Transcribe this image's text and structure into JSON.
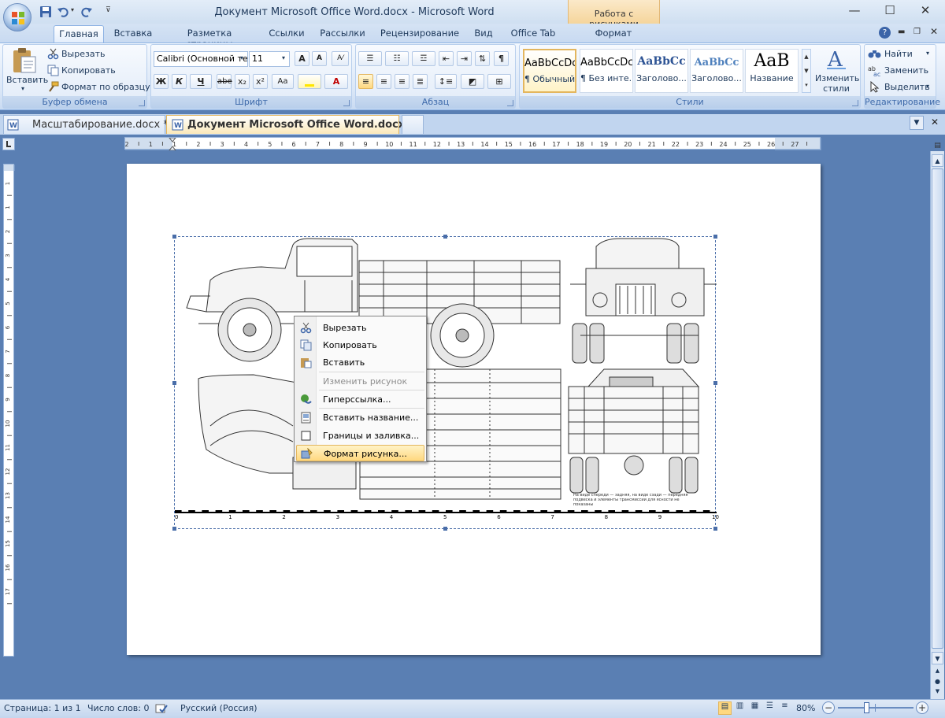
{
  "titlebar": {
    "title": "Документ Microsoft Office Word.docx - Microsoft Word",
    "context_tab": "Работа с рисунками",
    "minimize": "—",
    "maximize": "☐",
    "close": "✕"
  },
  "tabs": [
    "Главная",
    "Вставка",
    "Разметка страницы",
    "Ссылки",
    "Рассылки",
    "Рецензирование",
    "Вид",
    "Office Tab",
    "Формат"
  ],
  "ribbon": {
    "clipboard": {
      "label": "Буфер обмена",
      "paste": "Вставить",
      "cut": "Вырезать",
      "copy": "Копировать",
      "format_painter": "Формат по образцу"
    },
    "font": {
      "label": "Шрифт",
      "font_name": "Calibri (Основной те",
      "font_size": "11",
      "bold": "Ж",
      "italic": "К",
      "underline": "Ч",
      "strike": "abe",
      "subscript": "x₂",
      "superscript": "x²",
      "grow": "A",
      "shrink": "A",
      "change_case": "Aa",
      "font_color": "A"
    },
    "paragraph": {
      "label": "Абзац",
      "pilcrow": "¶"
    },
    "styles": {
      "label": "Стили",
      "items": [
        {
          "preview": "AaBbCcDc",
          "name": "¶ Обычный"
        },
        {
          "preview": "AaBbCcDc",
          "name": "¶ Без инте..."
        },
        {
          "preview": "AaBbCc",
          "name": "Заголово..."
        },
        {
          "preview": "AaBbCc",
          "name": "Заголово..."
        },
        {
          "preview": "AaB",
          "name": "Название"
        }
      ],
      "change_styles": "Изменить стили"
    },
    "editing": {
      "label": "Редактирование",
      "find": "Найти",
      "replace": "Заменить",
      "select": "Выделить"
    }
  },
  "doc_tabs": [
    {
      "label": "Масштабирование.docx *"
    },
    {
      "label": "Документ Microsoft Office Word.docx *"
    }
  ],
  "context_menu": {
    "items": [
      {
        "label": "Вырезать",
        "enabled": true
      },
      {
        "label": "Копировать",
        "enabled": true
      },
      {
        "label": "Вставить",
        "enabled": true
      },
      {
        "label": "Изменить рисунок",
        "enabled": false
      },
      {
        "label": "Гиперссылка...",
        "enabled": true
      },
      {
        "label": "Вставить название...",
        "enabled": true
      },
      {
        "label": "Границы и заливка...",
        "enabled": true
      },
      {
        "label": "Формат рисунка...",
        "enabled": true,
        "highlighted": true
      }
    ]
  },
  "drawing": {
    "scale_labels": [
      "0",
      "1",
      "2",
      "3",
      "4",
      "5",
      "6",
      "7",
      "8",
      "9",
      "10"
    ],
    "caption": "На виде спереди — задняя, на виде сзади — передняя подвеска и элементы трансмиссии для ясности не показаны"
  },
  "hruler_labels": [
    "2",
    "1",
    "1",
    "2",
    "3",
    "4",
    "5",
    "6",
    "7",
    "8",
    "9",
    "10",
    "11",
    "12",
    "13",
    "14",
    "15",
    "16",
    "17",
    "18",
    "19",
    "20",
    "21",
    "22",
    "23",
    "24",
    "25",
    "26",
    "27"
  ],
  "vruler_labels": [
    "1",
    "1",
    "2",
    "3",
    "4",
    "5",
    "6",
    "7",
    "8",
    "9",
    "10",
    "11",
    "12",
    "13",
    "14",
    "15",
    "16",
    "17"
  ],
  "statusbar": {
    "page": "Страница: 1 из 1",
    "words": "Число слов: 0",
    "language": "Русский (Россия)",
    "zoom": "80%",
    "zoom_level": 0.8
  },
  "colors": {
    "accent": "#1e395b",
    "ribbon": "#dbe7f7",
    "context": "#f5d59b",
    "highlight": "#ffd87f",
    "workspace": "#5a7fb3"
  }
}
